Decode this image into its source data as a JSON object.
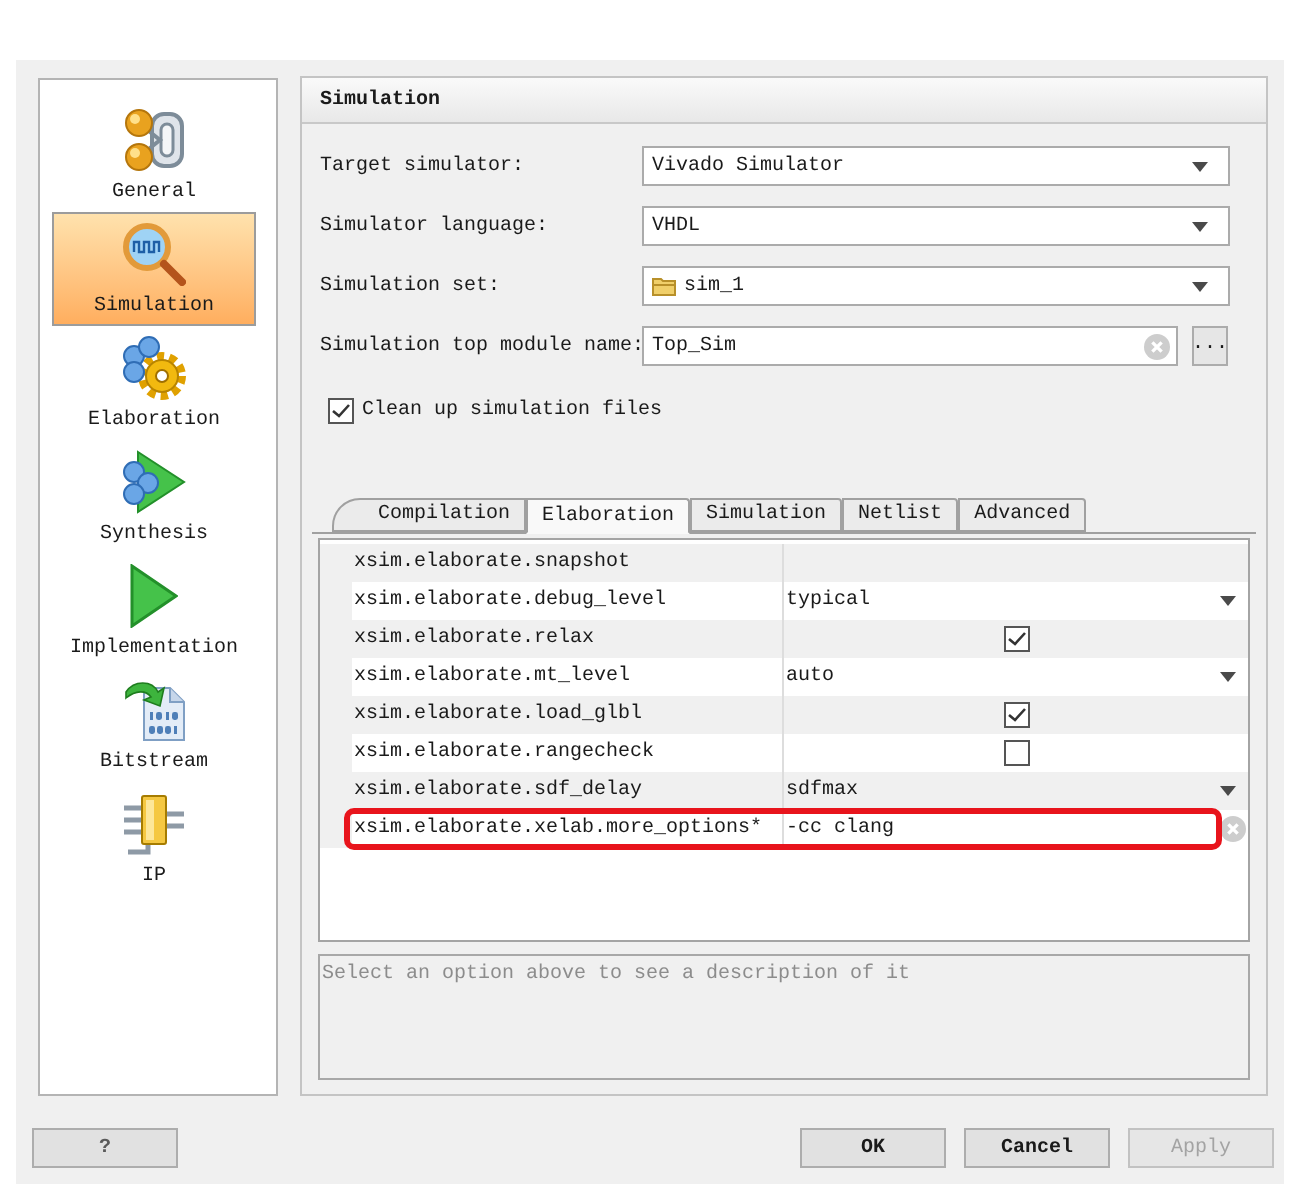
{
  "sidebar": {
    "items": [
      {
        "label": "General",
        "kind": "general",
        "selected": false
      },
      {
        "label": "Simulation",
        "kind": "simulation",
        "selected": true
      },
      {
        "label": "Elaboration",
        "kind": "elaboration",
        "selected": false
      },
      {
        "label": "Synthesis",
        "kind": "synthesis",
        "selected": false
      },
      {
        "label": "Implementation",
        "kind": "implementation",
        "selected": false
      },
      {
        "label": "Bitstream",
        "kind": "bitstream",
        "selected": false
      },
      {
        "label": "IP",
        "kind": "ip",
        "selected": false
      }
    ]
  },
  "panel": {
    "title": "Simulation",
    "fields": [
      {
        "label": "Target simulator:",
        "kind": "select",
        "value": "Vivado Simulator"
      },
      {
        "label": "Simulator language:",
        "kind": "select",
        "value": "VHDL"
      },
      {
        "label": "Simulation set:",
        "kind": "folder-select",
        "value": "sim_1"
      },
      {
        "label": "Simulation top module name:",
        "kind": "input",
        "value": "Top_Sim",
        "browse_label": "..."
      }
    ],
    "checkbox": {
      "label": "Clean up simulation files",
      "checked": true
    },
    "tabs": [
      {
        "label": "Compilation",
        "selected": false
      },
      {
        "label": "Elaboration",
        "selected": true
      },
      {
        "label": "Simulation",
        "selected": false
      },
      {
        "label": "Netlist",
        "selected": false
      },
      {
        "label": "Advanced",
        "selected": false
      }
    ],
    "table": {
      "rows": [
        {
          "name": "xsim.elaborate.snapshot",
          "kind": "empty",
          "highlighted": false
        },
        {
          "name": "xsim.elaborate.debug_level",
          "kind": "select",
          "value": "typical",
          "highlighted": false
        },
        {
          "name": "xsim.elaborate.relax",
          "kind": "checkbox",
          "checked": true,
          "highlighted": false
        },
        {
          "name": "xsim.elaborate.mt_level",
          "kind": "select",
          "value": "auto",
          "highlighted": false
        },
        {
          "name": "xsim.elaborate.load_glbl",
          "kind": "checkbox",
          "checked": true,
          "highlighted": false
        },
        {
          "name": "xsim.elaborate.rangecheck",
          "kind": "checkbox",
          "checked": false,
          "highlighted": false
        },
        {
          "name": "xsim.elaborate.sdf_delay",
          "kind": "select",
          "value": "sdfmax",
          "highlighted": false
        },
        {
          "name": "xsim.elaborate.xelab.more_options*",
          "kind": "input",
          "value": "-cc clang",
          "highlighted": true
        }
      ]
    },
    "description": {
      "text": "Select an option above to see a description of it"
    }
  },
  "buttons": [
    {
      "label": "?",
      "kind": "help",
      "disabled": false
    },
    {
      "label": "OK",
      "kind": "action",
      "disabled": false
    },
    {
      "label": "Cancel",
      "kind": "action",
      "disabled": false
    },
    {
      "label": "Apply",
      "kind": "action",
      "disabled": true
    }
  ]
}
